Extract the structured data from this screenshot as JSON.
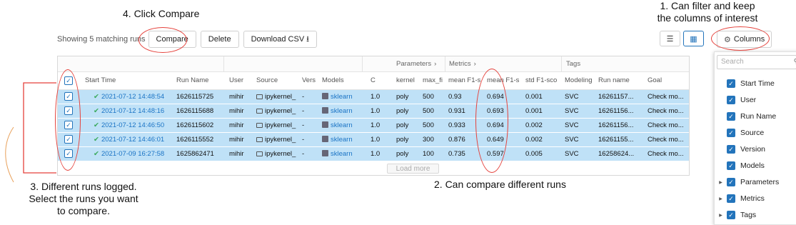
{
  "annotations": {
    "step4": "4. Click Compare",
    "step1_line1": "1. Can filter and keep",
    "step1_line2": "the columns of interest",
    "step2": "2. Can compare different runs",
    "step3_line1": "3. Different runs logged.",
    "step3_line2": "Select the runs you want",
    "step3_line3": "to compare."
  },
  "toolbar": {
    "showing": "Showing 5 matching runs",
    "compare": "Compare",
    "delete": "Delete",
    "download": "Download CSV",
    "download_icon": "download-icon",
    "columns": "Columns",
    "columns_icon": "gear-icon",
    "list_view_icon": "list-icon",
    "table_view_icon": "table-icon"
  },
  "groups": {
    "parameters": "Parameters",
    "metrics": "Metrics",
    "tags": "Tags"
  },
  "headers": [
    "Start Time",
    "Run Name",
    "User",
    "Source",
    "Vers",
    "Models",
    "C",
    "kernel",
    "max_fi",
    "mean F1-s",
    "mean F1-s",
    "std F1-sco",
    "Modeling",
    "Run name",
    "Goal"
  ],
  "rows": [
    {
      "start_time": "2021-07-12 14:48:54",
      "run_name": "1626115725",
      "user": "mihir",
      "source": "ipykernel_",
      "version": "-",
      "model": "sklearn",
      "c": "1.0",
      "kernel": "poly",
      "max_fi": "500",
      "m1": "0.93",
      "m2": "0.694",
      "std": "0.001",
      "modeling": "SVC",
      "run_name_tag": "16261157...",
      "goal": "Check mo..."
    },
    {
      "start_time": "2021-07-12 14:48:16",
      "run_name": "1626115688",
      "user": "mihir",
      "source": "ipykernel_",
      "version": "-",
      "model": "sklearn",
      "c": "1.0",
      "kernel": "poly",
      "max_fi": "500",
      "m1": "0.931",
      "m2": "0.693",
      "std": "0.001",
      "modeling": "SVC",
      "run_name_tag": "16261156...",
      "goal": "Check mo..."
    },
    {
      "start_time": "2021-07-12 14:46:50",
      "run_name": "1626115602",
      "user": "mihir",
      "source": "ipykernel_",
      "version": "-",
      "model": "sklearn",
      "c": "1.0",
      "kernel": "poly",
      "max_fi": "500",
      "m1": "0.933",
      "m2": "0.694",
      "std": "0.002",
      "modeling": "SVC",
      "run_name_tag": "16261156...",
      "goal": "Check mo..."
    },
    {
      "start_time": "2021-07-12 14:46:01",
      "run_name": "1626115552",
      "user": "mihir",
      "source": "ipykernel_",
      "version": "-",
      "model": "sklearn",
      "c": "1.0",
      "kernel": "poly",
      "max_fi": "300",
      "m1": "0.876",
      "m2": "0.649",
      "std": "0.002",
      "modeling": "SVC",
      "run_name_tag": "16261155...",
      "goal": "Check mo..."
    },
    {
      "start_time": "2021-07-09 16:27:58",
      "run_name": "1625862471",
      "user": "mihir",
      "source": "ipykernel_",
      "version": "-",
      "model": "sklearn",
      "c": "1.0",
      "kernel": "poly",
      "max_fi": "100",
      "m1": "0.735",
      "m2": "0.597",
      "std": "0.005",
      "modeling": "SVC",
      "run_name_tag": "16258624...",
      "goal": "Check mo..."
    }
  ],
  "load_more": "Load more",
  "column_panel": {
    "search_placeholder": "Search",
    "items": [
      "Start Time",
      "User",
      "Run Name",
      "Source",
      "Version",
      "Models",
      "Parameters",
      "Metrics",
      "Tags"
    ]
  },
  "colors": {
    "accent": "#2374bb",
    "row_selected": "#bfe1f7",
    "annotation_circle": "#e5413b",
    "success": "#3aaa5c"
  }
}
